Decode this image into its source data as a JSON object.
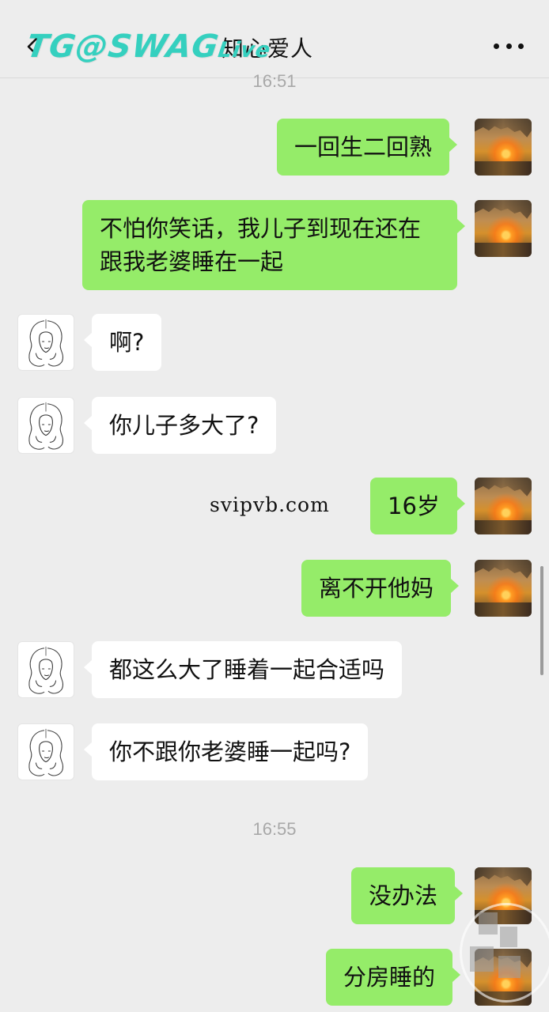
{
  "header": {
    "title": "知心爱人",
    "watermark_main": "TG@SWAG",
    "watermark_small": "Live"
  },
  "messages": [
    {
      "type": "time",
      "text": "16:51"
    },
    {
      "type": "out",
      "text": "一回生二回熟"
    },
    {
      "type": "out",
      "text": "不怕你笑话，我儿子到现在还在跟我老婆睡在一起"
    },
    {
      "type": "in",
      "text": "啊?"
    },
    {
      "type": "in",
      "text": "你儿子多大了?"
    },
    {
      "type": "out",
      "text": "16岁"
    },
    {
      "type": "out",
      "text": "离不开他妈"
    },
    {
      "type": "in",
      "text": "都这么大了睡着一起合适吗"
    },
    {
      "type": "in",
      "text": "你不跟你老婆睡一起吗?"
    },
    {
      "type": "time",
      "text": "16:55"
    },
    {
      "type": "out",
      "text": "没办法"
    },
    {
      "type": "out",
      "text": "分房睡的"
    }
  ],
  "overlay_text": {
    "site": "svipvb.com"
  },
  "colors": {
    "background": "#ededed",
    "outgoing_bubble": "#95ec69",
    "incoming_bubble": "#ffffff",
    "watermark": "#35d0bf",
    "timestamp": "#a8a8a8"
  },
  "icons": {
    "back": "chevron-left-icon",
    "more": "more-icon"
  }
}
